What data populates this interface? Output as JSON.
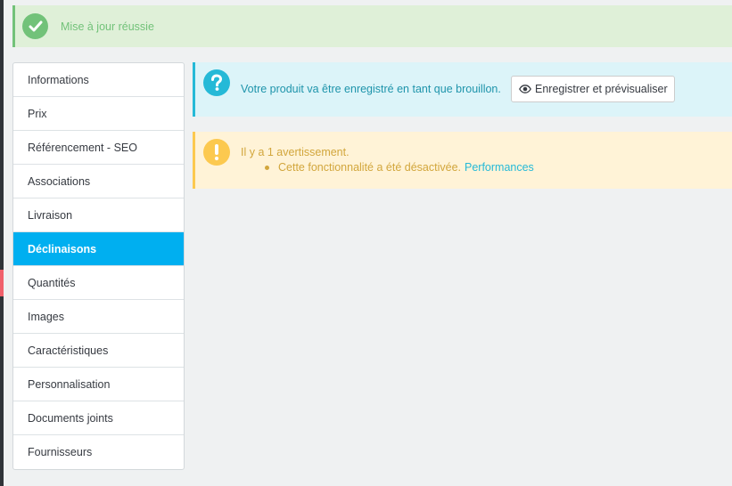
{
  "success_alert": {
    "message": "Mise à jour réussie",
    "icon": "check-icon",
    "color": "#72c279"
  },
  "tabs": {
    "active_index": 5,
    "items": [
      {
        "label": "Informations"
      },
      {
        "label": "Prix"
      },
      {
        "label": "Référencement - SEO"
      },
      {
        "label": "Associations"
      },
      {
        "label": "Livraison"
      },
      {
        "label": "Déclinaisons"
      },
      {
        "label": "Quantités"
      },
      {
        "label": "Images"
      },
      {
        "label": "Caractéristiques"
      },
      {
        "label": "Personnalisation"
      },
      {
        "label": "Documents joints"
      },
      {
        "label": "Fournisseurs"
      }
    ],
    "active_color": "#00aff0"
  },
  "info_alert": {
    "message": "Votre produit va être enregistré en tant que brouillon.",
    "icon": "question-icon",
    "button_label": "Enregistrer et prévisualiser",
    "button_icon": "eye-icon",
    "color": "#25b9d7"
  },
  "warning_alert": {
    "title": "Il y a 1 avertissement.",
    "icon": "exclamation-icon",
    "item_text": "Cette fonctionnalité a été désactivée.",
    "item_link": "Performances",
    "color": "#fcc94f"
  }
}
